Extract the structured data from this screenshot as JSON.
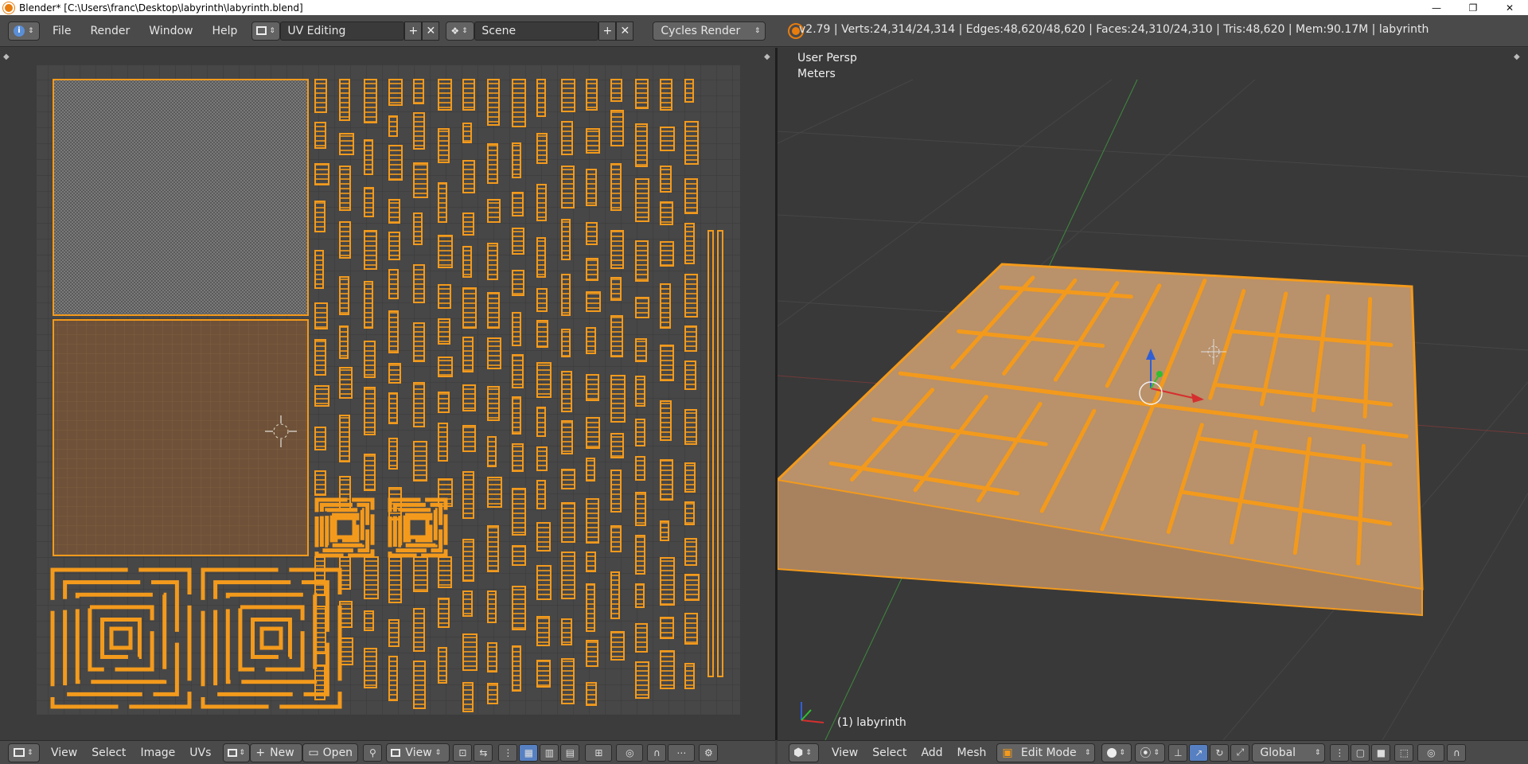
{
  "window": {
    "title": "Blender* [C:\\Users\\franc\\Desktop\\labyrinth\\labyrinth.blend]",
    "minimize": "—",
    "restore": "❐",
    "close": "✕"
  },
  "info_header": {
    "menus": [
      "File",
      "Render",
      "Window",
      "Help"
    ],
    "screen_layout": "UV Editing",
    "scene": "Scene",
    "render_engine": "Cycles Render",
    "stats": "v2.79 | Verts:24,314/24,314 | Edges:48,620/48,620 | Faces:24,310/24,310 | Tris:48,620 | Mem:90.17M | labyrinth"
  },
  "uv_editor": {
    "footer_menus": [
      "View",
      "Select",
      "Image",
      "UVs"
    ],
    "new_label": "New",
    "open_label": "Open",
    "view_label": "View"
  },
  "viewport": {
    "view_name": "User Persp",
    "units": "Meters",
    "object_label": "(1) labyrinth",
    "footer_menus": [
      "View",
      "Select",
      "Add",
      "Mesh"
    ],
    "mode": "Edit Mode",
    "orientation": "Global"
  },
  "colors": {
    "accent": "#f39a1c",
    "selected_face": "#7a5a3a",
    "wall": "#c9a57e",
    "grid_bg": "#464646",
    "active_button": "#5680c2"
  }
}
